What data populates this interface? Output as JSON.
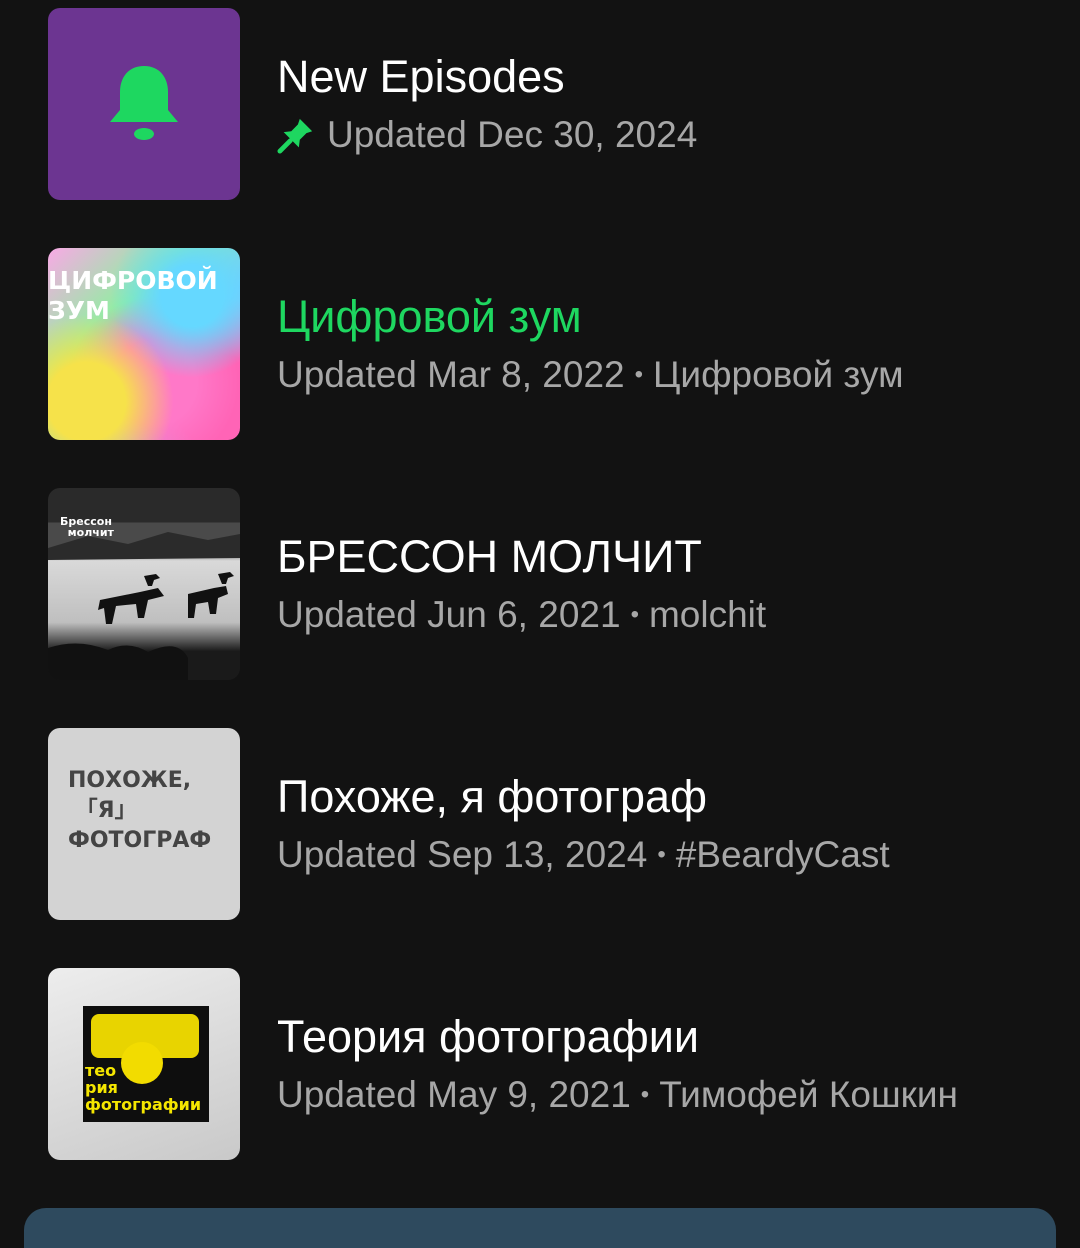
{
  "items": [
    {
      "title": "New Episodes",
      "updated": "Updated Dec 30, 2024",
      "author": "",
      "pinned": true,
      "active": false,
      "thumb_icon": "bell-icon",
      "thumb_color": "#6c3591",
      "accent_color": "#1ed760"
    },
    {
      "title": "Цифровой зум",
      "updated": "Updated Mar 8, 2022",
      "author": "Цифровой зум",
      "pinned": false,
      "active": true,
      "thumb_text": "ЦИФРОВОЙ\nЗУМ"
    },
    {
      "title": "БРЕССОН МОЛЧИТ",
      "updated": "Updated Jun 6, 2021",
      "author": "molchit",
      "pinned": false,
      "active": false,
      "thumb_text": "Брессон\nмолчит"
    },
    {
      "title": "Похоже, я фотограф",
      "updated": "Updated Sep 13, 2024",
      "author": "#BeardyCast",
      "pinned": false,
      "active": false,
      "thumb_text": "ПОХОЖЕ,\n「Я」\nФОТОГРАФ"
    },
    {
      "title": "Теория фотографии",
      "updated": "Updated May 9, 2021",
      "author": "Тимофей Кошкин",
      "pinned": false,
      "active": false,
      "thumb_text": "тео\nрия\nфотографии"
    }
  ],
  "separator": "•"
}
